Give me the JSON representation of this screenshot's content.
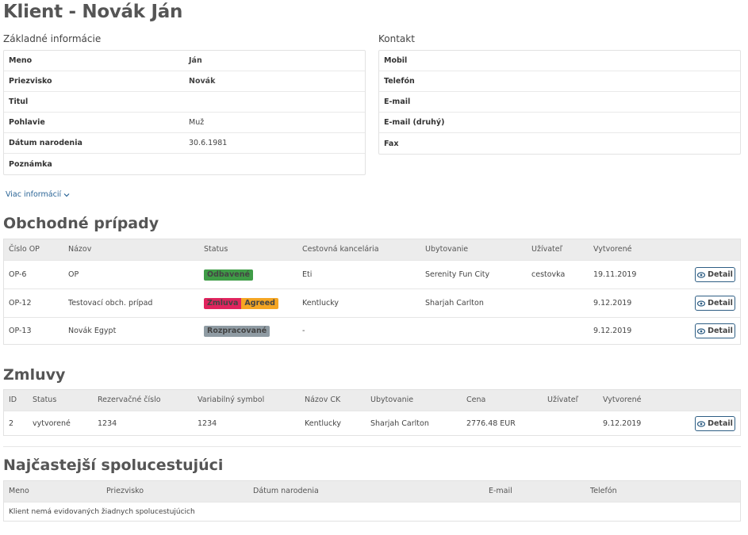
{
  "page_title": "Klient - Novák Ján",
  "basic_info": {
    "title": "Základné informácie",
    "rows": [
      {
        "label": "Meno",
        "value": "Ján"
      },
      {
        "label": "Priezvisko",
        "value": "Novák"
      },
      {
        "label": "Titul",
        "value": ""
      },
      {
        "label": "Pohlavie",
        "value": "Muž"
      },
      {
        "label": "Dátum narodenia",
        "value": "30.6.1981"
      },
      {
        "label": "Poznámka",
        "value": ""
      }
    ]
  },
  "contact": {
    "title": "Kontakt",
    "rows": [
      {
        "label": "Mobil"
      },
      {
        "label": "Telefón"
      },
      {
        "label": "E-mail"
      },
      {
        "label": "E-mail (druhý)"
      },
      {
        "label": "Fax"
      }
    ]
  },
  "more_info_link": "Viac informácií",
  "cases": {
    "title": "Obchodné prípady",
    "headers": [
      "Číslo OP",
      "Názov",
      "Status",
      "Cestovná kancelária",
      "Ubytovanie",
      "Užívateľ",
      "Vytvorené"
    ],
    "rows": [
      {
        "id": "OP-6",
        "name": "OP",
        "badges": [
          {
            "text": "Odbavené",
            "color": "#3f9c47"
          }
        ],
        "agency": "Eti",
        "accommodation": "Serenity Fun City",
        "user": "cestovka",
        "created": "19.11.2019"
      },
      {
        "id": "OP-12",
        "name": "Testovací obch. prípad",
        "badges": [
          {
            "text": "Zmluva",
            "color": "#e0245e"
          },
          {
            "text": "Agreed",
            "color": "#f5a623"
          }
        ],
        "agency": "Kentlucky",
        "accommodation": "Sharjah Carlton",
        "user": "",
        "created": "9.12.2019"
      },
      {
        "id": "OP-13",
        "name": "Novák Egypt",
        "badges": [
          {
            "text": "Rozpracované",
            "color": "#8f9ba3"
          }
        ],
        "agency": "-",
        "accommodation": "",
        "user": "",
        "created": "9.12.2019"
      }
    ],
    "detail_label": "Detail"
  },
  "contracts": {
    "title": "Zmluvy",
    "headers": [
      "ID",
      "Status",
      "Rezervačné číslo",
      "Variabilný symbol",
      "Názov CK",
      "Ubytovanie",
      "Cena",
      "Užívateľ",
      "Vytvorené"
    ],
    "rows": [
      {
        "id": "2",
        "status": "vytvorené",
        "reservation": "1234",
        "variable_symbol": "1234",
        "agency": "Kentlucky",
        "accommodation": "Sharjah Carlton",
        "price": "2776.48 EUR",
        "user": "",
        "created": "9.12.2019"
      }
    ],
    "detail_label": "Detail"
  },
  "companions": {
    "title": "Najčastejší spolucestujúci",
    "headers": [
      "Meno",
      "Priezvisko",
      "Dátum narodenia",
      "E-mail",
      "Telefón"
    ],
    "empty_text": "Klient nemá evidovaných žiadnych spolucestujúcich"
  },
  "colors": {
    "accent": "#2e5e84",
    "link": "#2a6496",
    "header_bg": "#ececec"
  }
}
